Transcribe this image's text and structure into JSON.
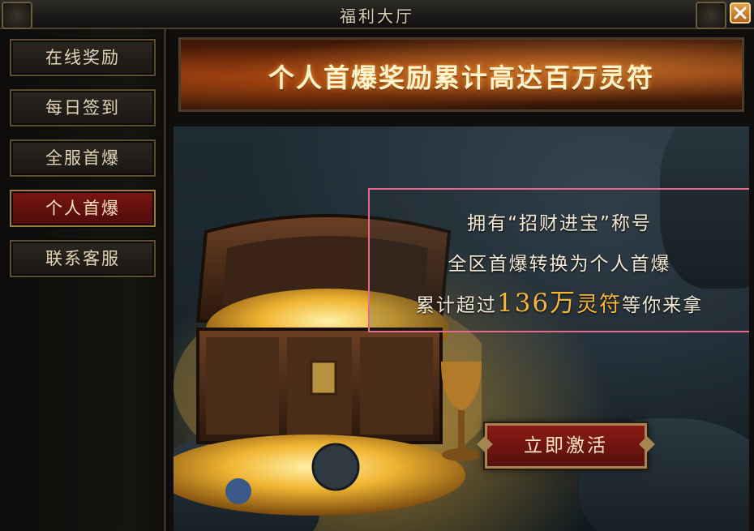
{
  "window": {
    "title": "福利大厅"
  },
  "sidebar": {
    "items": [
      {
        "label": "在线奖励",
        "active": false
      },
      {
        "label": "每日签到",
        "active": false
      },
      {
        "label": "全服首爆",
        "active": false
      },
      {
        "label": "个人首爆",
        "active": true
      },
      {
        "label": "联系客服",
        "active": false
      }
    ]
  },
  "banner": {
    "text": "个人首爆奖励累计高达百万灵符"
  },
  "info": {
    "line1": "拥有“招财进宝”称号",
    "line2": "全区首爆转换为个人首爆",
    "line3_prefix": "累计超过",
    "line3_amount": "136万",
    "line3_currency": "灵符",
    "line3_suffix": "等你来拿"
  },
  "activate_button": {
    "label": "立即激活"
  },
  "icons": {
    "close": "close-icon",
    "chest": "treasure-chest-icon"
  },
  "colors": {
    "accent_gold": "#f7b63a",
    "active_menu": "#7a1512",
    "highlight_border": "#e36a8d"
  }
}
